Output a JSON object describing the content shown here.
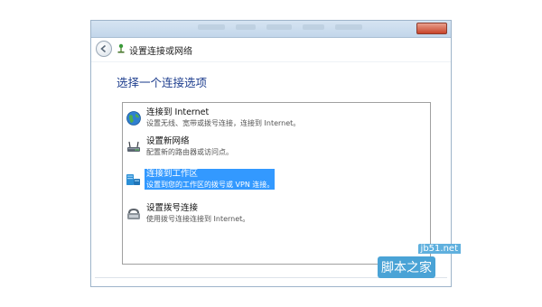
{
  "navbar": {
    "title": "设置连接或网络",
    "back_icon": "back-arrow-icon",
    "network_icon": "network-icon"
  },
  "main": {
    "heading": "选择一个连接选项",
    "options": [
      {
        "title": "连接到 Internet",
        "description": "设置无线、宽带或拨号连接，连接到 Internet。",
        "icon": "globe-icon",
        "selected": false
      },
      {
        "title": "设置新网络",
        "description": "配置新的路由器或访问点。",
        "icon": "router-icon",
        "selected": false
      },
      {
        "title": "连接到工作区",
        "description": "设置到您的工作区的拨号或 VPN 连接。",
        "icon": "workplace-icon",
        "selected": true
      },
      {
        "title": "设置拨号连接",
        "description": "使用拨号连接连接到 Internet。",
        "icon": "phone-icon",
        "selected": false
      }
    ]
  },
  "watermark": {
    "site": "jb51.net",
    "brand": "脚本之家"
  },
  "colors": {
    "selection": "#3399ff",
    "heading": "#1e3e8e",
    "watermark": "#4aa3d6"
  }
}
